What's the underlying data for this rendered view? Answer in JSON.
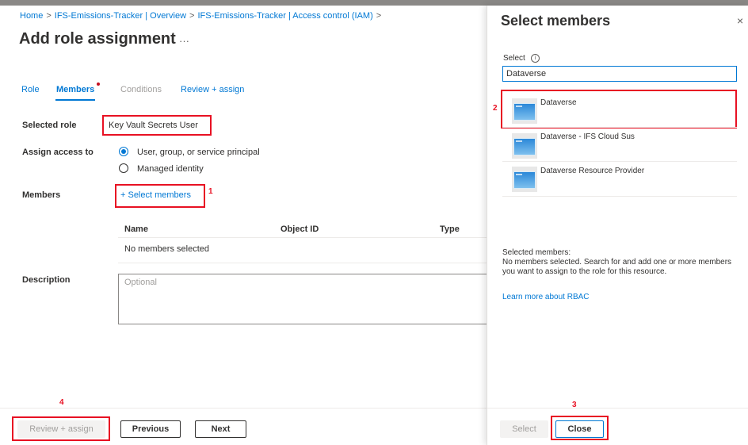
{
  "breadcrumb": [
    "Home",
    "IFS-Emissions-Tracker | Overview",
    "IFS-Emissions-Tracker | Access control (IAM)"
  ],
  "breadcrumb_sep": ">",
  "page": {
    "title": "Add role assignment",
    "more": "···"
  },
  "tabs": {
    "role": "Role",
    "members": "Members",
    "conditions": "Conditions",
    "review": "Review + assign"
  },
  "form": {
    "selected_role_label": "Selected role",
    "selected_role_value": "Key Vault Secrets User",
    "assign_access_label": "Assign access to",
    "options": [
      {
        "label": "User, group, or service principal",
        "selected": true
      },
      {
        "label": "Managed identity",
        "selected": false
      }
    ],
    "members_label": "Members",
    "select_members_link": "+ Select members",
    "table_headers": [
      "Name",
      "Object ID",
      "Type"
    ],
    "empty_text": "No members selected",
    "description_label": "Description",
    "description_placeholder": "Optional"
  },
  "buttons": {
    "review_assign": "Review + assign",
    "previous": "Previous",
    "next": "Next"
  },
  "panel": {
    "title": "Select members",
    "close_glyph": "×",
    "select_label": "Select",
    "search_value": "Dataverse",
    "results": [
      "Dataverse",
      "Dataverse - IFS Cloud Sus",
      "Dataverse Resource Provider"
    ],
    "selected_members_title": "Selected members:",
    "selected_members_text": "No members selected. Search for and add one or more members you want to assign to the role for this resource.",
    "rbac_link": "Learn more about RBAC",
    "select_button": "Select",
    "close_button": "Close"
  },
  "annotations": {
    "n1": "1",
    "n2": "2",
    "n3": "3",
    "n4": "4"
  },
  "colors": {
    "accent": "#0078d4",
    "annotation_red": "#e81123"
  }
}
